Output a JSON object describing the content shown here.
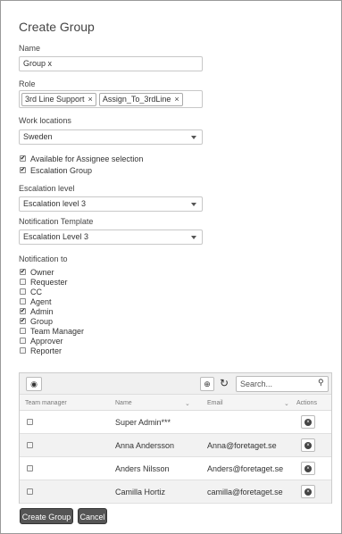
{
  "title": "Create Group",
  "name": {
    "label": "Name",
    "value": "Group x"
  },
  "role": {
    "label": "Role",
    "tags": [
      "3rd Line Support",
      "Assign_To_3rdLine"
    ]
  },
  "work_locations": {
    "label": "Work locations",
    "value": "Sweden"
  },
  "options": [
    {
      "label": "Available for Assignee selection",
      "checked": true
    },
    {
      "label": "Escalation Group",
      "checked": true
    }
  ],
  "escalation_level": {
    "label": "Escalation level",
    "value": "Escalation level 3"
  },
  "notification_template": {
    "label": "Notification Template",
    "value": "Escalation Level 3"
  },
  "notification_to": {
    "label": "Notification to",
    "items": [
      {
        "label": "Owner",
        "checked": true
      },
      {
        "label": "Requester",
        "checked": false
      },
      {
        "label": "CC",
        "checked": false
      },
      {
        "label": "Agent",
        "checked": false
      },
      {
        "label": "Admin",
        "checked": true
      },
      {
        "label": "Group",
        "checked": true
      },
      {
        "label": "Team Manager",
        "checked": false
      },
      {
        "label": "Approver",
        "checked": false
      },
      {
        "label": "Reporter",
        "checked": false
      }
    ]
  },
  "grid": {
    "search_placeholder": "Search...",
    "columns": {
      "team_manager": "Team manager",
      "name": "Name",
      "email": "Email",
      "actions": "Actions"
    },
    "rows": [
      {
        "name": "Super Admin***",
        "email": ""
      },
      {
        "name": "Anna Andersson",
        "email": "Anna@foretaget.se"
      },
      {
        "name": "Anders Nilsson",
        "email": "Anders@foretaget.se"
      },
      {
        "name": "Camilla Hortiz",
        "email": "camilla@foretaget.se"
      }
    ]
  },
  "buttons": {
    "create": "Create Group",
    "cancel": "Cancel"
  }
}
